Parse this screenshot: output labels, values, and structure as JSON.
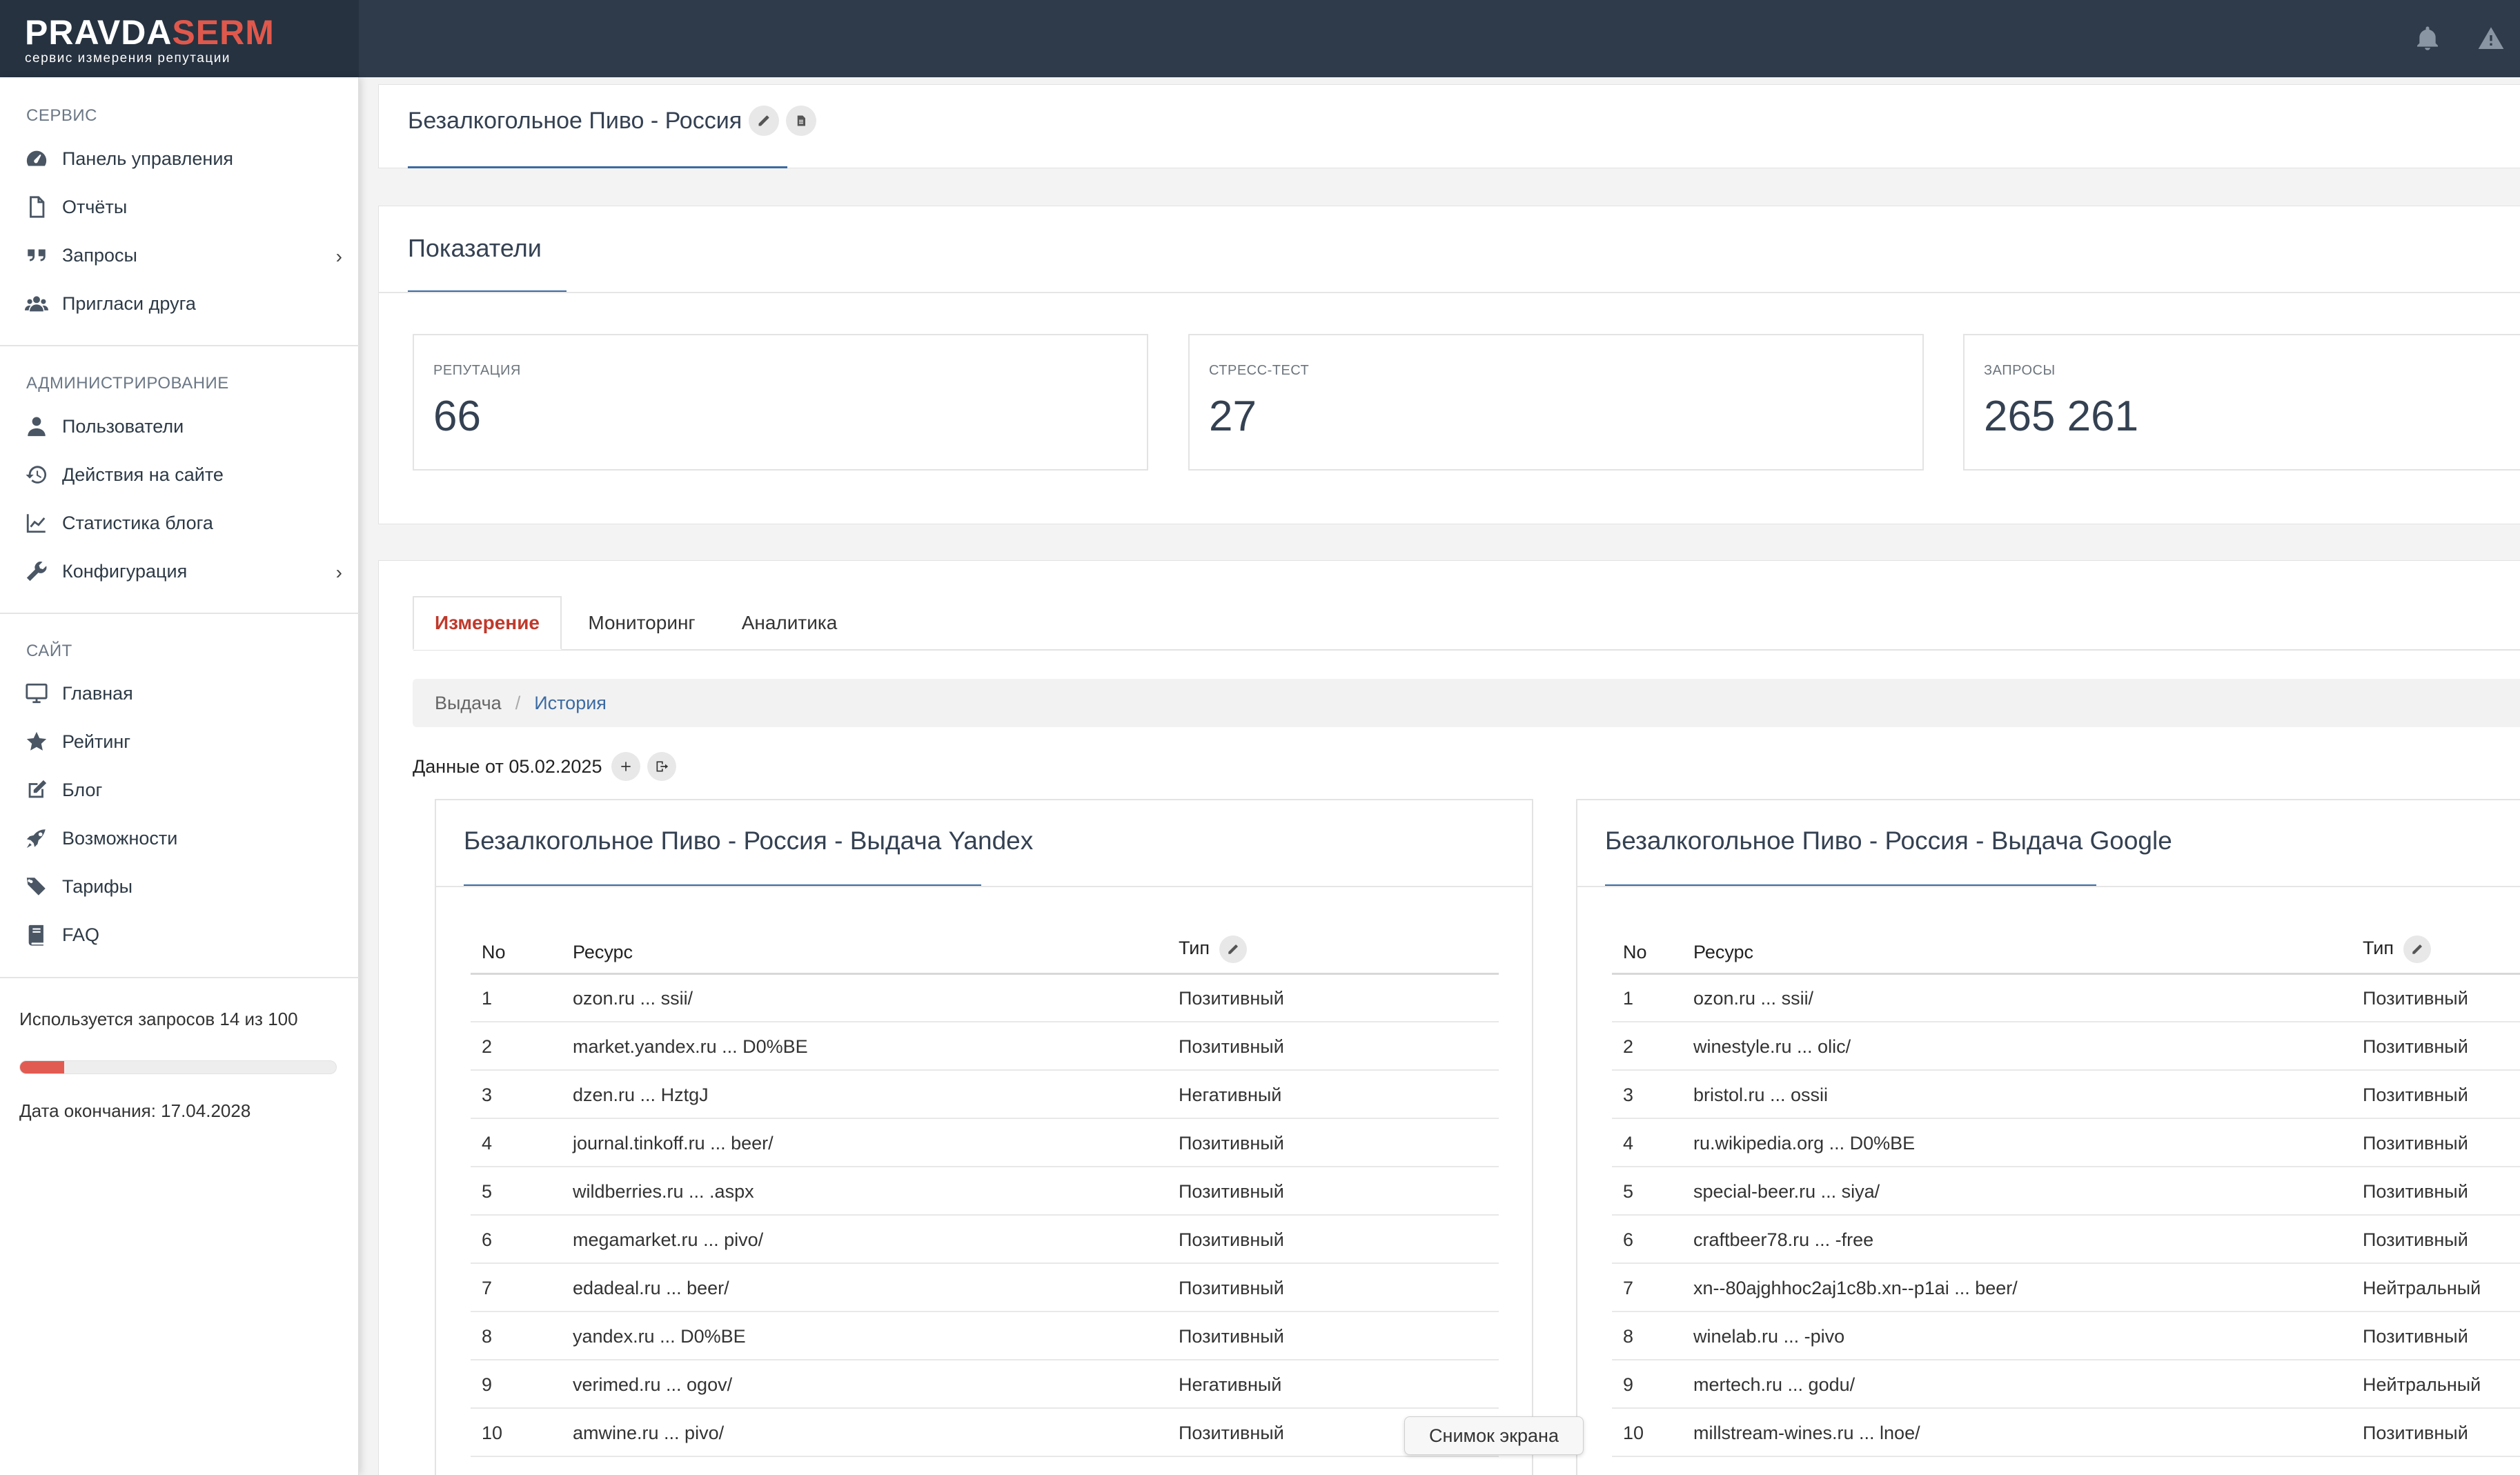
{
  "logo": {
    "part1": "PRAVDA",
    "part2": "SERM",
    "subtitle": "сервис измерения репутации"
  },
  "sidebar": {
    "section_service": "СЕРВИС",
    "service_items": [
      {
        "label": "Панель управления",
        "icon": "dashboard-icon"
      },
      {
        "label": "Отчёты",
        "icon": "file-icon"
      },
      {
        "label": "Запросы",
        "icon": "quote-icon"
      },
      {
        "label": "Пригласи друга",
        "icon": "users-icon"
      }
    ],
    "section_admin": "АДМИНИСТРИРОВАНИЕ",
    "admin_items": [
      {
        "label": "Пользователи",
        "icon": "user-icon"
      },
      {
        "label": "Действия на сайте",
        "icon": "history-icon"
      },
      {
        "label": "Статистика блога",
        "icon": "chart-icon"
      },
      {
        "label": "Конфигурация",
        "icon": "wrench-icon"
      }
    ],
    "section_site": "САЙТ",
    "site_items": [
      {
        "label": "Главная",
        "icon": "desktop-icon"
      },
      {
        "label": "Рейтинг",
        "icon": "star-icon"
      },
      {
        "label": "Блог",
        "icon": "edit-icon"
      },
      {
        "label": "Возможности",
        "icon": "rocket-icon"
      },
      {
        "label": "Тарифы",
        "icon": "tags-icon"
      },
      {
        "label": "FAQ",
        "icon": "book-icon"
      }
    ],
    "usage_text": "Используется запросов 14 из 100",
    "usage_fraction": 0.14,
    "end_date": "Дата окончания: 17.04.2028"
  },
  "header": {
    "project_title": "Безалкогольное Пиво - Россия"
  },
  "indicators": {
    "title": "Показатели",
    "stats": [
      {
        "label": "РЕПУТАЦИЯ",
        "value": "66"
      },
      {
        "label": "СТРЕСС-ТЕСТ",
        "value": "27"
      },
      {
        "label": "ЗАПРОСЫ",
        "value": "265 261"
      }
    ]
  },
  "tabs": [
    "Измерение",
    "Мониторинг",
    "Аналитика"
  ],
  "breadcrumb": {
    "item1": "Выдача",
    "item2": "История"
  },
  "data_from": "Данные от 05.02.2025",
  "columns": {
    "no": "No",
    "resource": "Ресурс",
    "type": "Тип"
  },
  "yandex": {
    "title": "Безалкогольное Пиво - Россия - Выдача Yandex",
    "rows": [
      {
        "no": "1",
        "resource": "ozon.ru ... ssii/",
        "type": "Позитивный",
        "kind": "pos"
      },
      {
        "no": "2",
        "resource": "market.yandex.ru ... D0%BE",
        "type": "Позитивный",
        "kind": "pos"
      },
      {
        "no": "3",
        "resource": "dzen.ru ... HztgJ",
        "type": "Негативный",
        "kind": "neg"
      },
      {
        "no": "4",
        "resource": "journal.tinkoff.ru ... beer/",
        "type": "Позитивный",
        "kind": "pos"
      },
      {
        "no": "5",
        "resource": "wildberries.ru ... .aspx",
        "type": "Позитивный",
        "kind": "pos"
      },
      {
        "no": "6",
        "resource": "megamarket.ru ... pivo/",
        "type": "Позитивный",
        "kind": "pos"
      },
      {
        "no": "7",
        "resource": "edadeal.ru ... beer/",
        "type": "Позитивный",
        "kind": "pos"
      },
      {
        "no": "8",
        "resource": "yandex.ru ... D0%BE",
        "type": "Позитивный",
        "kind": "pos"
      },
      {
        "no": "9",
        "resource": "verimed.ru ... ogov/",
        "type": "Негативный",
        "kind": "neg"
      },
      {
        "no": "10",
        "resource": "amwine.ru ... pivo/",
        "type": "Позитивный",
        "kind": "pos"
      }
    ]
  },
  "google": {
    "title": "Безалкогольное Пиво - Россия - Выдача Google",
    "rows": [
      {
        "no": "1",
        "resource": "ozon.ru ... ssii/",
        "type": "Позитивный",
        "kind": "pos"
      },
      {
        "no": "2",
        "resource": "winestyle.ru ... olic/",
        "type": "Позитивный",
        "kind": "pos"
      },
      {
        "no": "3",
        "resource": "bristol.ru ... ossii",
        "type": "Позитивный",
        "kind": "pos"
      },
      {
        "no": "4",
        "resource": "ru.wikipedia.org ... D0%BE",
        "type": "Позитивный",
        "kind": "pos"
      },
      {
        "no": "5",
        "resource": "special-beer.ru ... siya/",
        "type": "Позитивный",
        "kind": "pos"
      },
      {
        "no": "6",
        "resource": "craftbeer78.ru ... -free",
        "type": "Позитивный",
        "kind": "pos"
      },
      {
        "no": "7",
        "resource": "xn--80ajghhoc2aj1c8b.xn--p1ai ... beer/",
        "type": "Нейтральный",
        "kind": "neu"
      },
      {
        "no": "8",
        "resource": "winelab.ru ... -pivo",
        "type": "Позитивный",
        "kind": "pos"
      },
      {
        "no": "9",
        "resource": "mertech.ru ... godu/",
        "type": "Нейтральный",
        "kind": "neu"
      },
      {
        "no": "10",
        "resource": "millstream-wines.ru ... lnoe/",
        "type": "Позитивный",
        "kind": "pos"
      }
    ]
  },
  "tooltip": "Снимок экрана",
  "colors": {
    "positive": "#2eb82e",
    "negative": "#d63031",
    "neutral": "#8e2fd9",
    "accent": "#e0584c",
    "link": "#2f6ab0"
  }
}
